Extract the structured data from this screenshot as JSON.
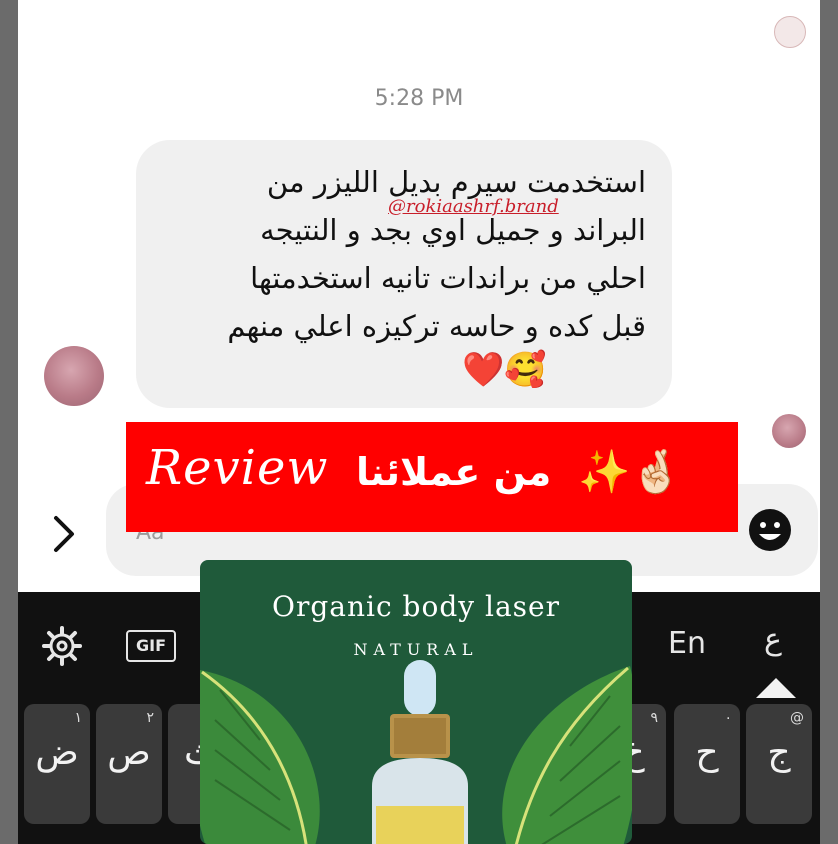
{
  "chat": {
    "timestamp": "5:28 PM",
    "message_lines": [
      "استخدمت سيرم بديل الليزر من",
      "البراند و جميل اوي بجد و النتيجه",
      "احلي من براندات تانيه استخدمتها",
      "قبل كده و حاسه تركيزه اعلي منهم"
    ],
    "message_emojis": "❤️🥰",
    "watermark_handle": "@rokiaashrf.brand",
    "composer_placeholder": "Aa"
  },
  "banner": {
    "english": "Review",
    "arabic": "من عملائنا",
    "emojis": "✨🤞🏻",
    "background": "#ff0000"
  },
  "keyboard": {
    "gif_label": "GIF",
    "lang_en": "En",
    "lang_ar": "ع",
    "keys": [
      {
        "main": "ض",
        "sub": "١"
      },
      {
        "main": "ص",
        "sub": "٢"
      },
      {
        "main": "ث",
        "sub": ""
      },
      {
        "main": "خ",
        "sub": "٩"
      },
      {
        "main": "ح",
        "sub": "٠"
      },
      {
        "main": "ج",
        "sub": "@"
      }
    ]
  },
  "product": {
    "title": "Organic body laser",
    "subtitle": "NATURAL"
  },
  "colors": {
    "keyboard_bg": "#111111",
    "key_bg": "#3a3a3a",
    "product_bg": "#1f5a3a",
    "accent_red": "#ff0000"
  }
}
